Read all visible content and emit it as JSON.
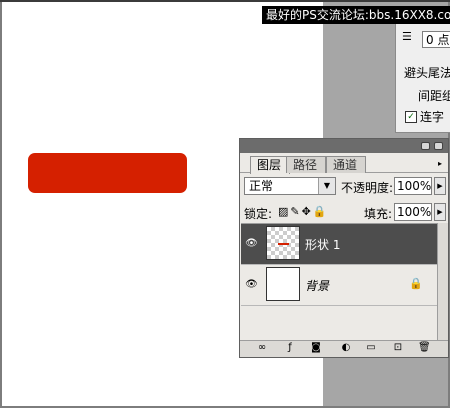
{
  "watermark": "最好的PS交流论坛:bbs.16XX8.com",
  "character_panel": {
    "leading_value": "0 点",
    "kinsoku_label": "避头尾法",
    "spacing_label": "间距组",
    "ligature_label": "连字",
    "ligature_checked": "✓"
  },
  "layers_panel": {
    "tabs": [
      "图层",
      "路径",
      "通道"
    ],
    "menu_arrow": "▸",
    "blend_mode": "正常",
    "opacity_label": "不透明度:",
    "opacity_value": "100%",
    "lock_label": "锁定:",
    "fill_label": "填充:",
    "fill_value": "100%",
    "layers": [
      {
        "name": "形状 1",
        "selected": true
      },
      {
        "name": "背景",
        "selected": false
      }
    ]
  },
  "colors": {
    "shape_red": "#d52000",
    "selected_layer": "#4d4d4d",
    "canvas": "#ffffff",
    "workspace": "#a6a6a6"
  }
}
